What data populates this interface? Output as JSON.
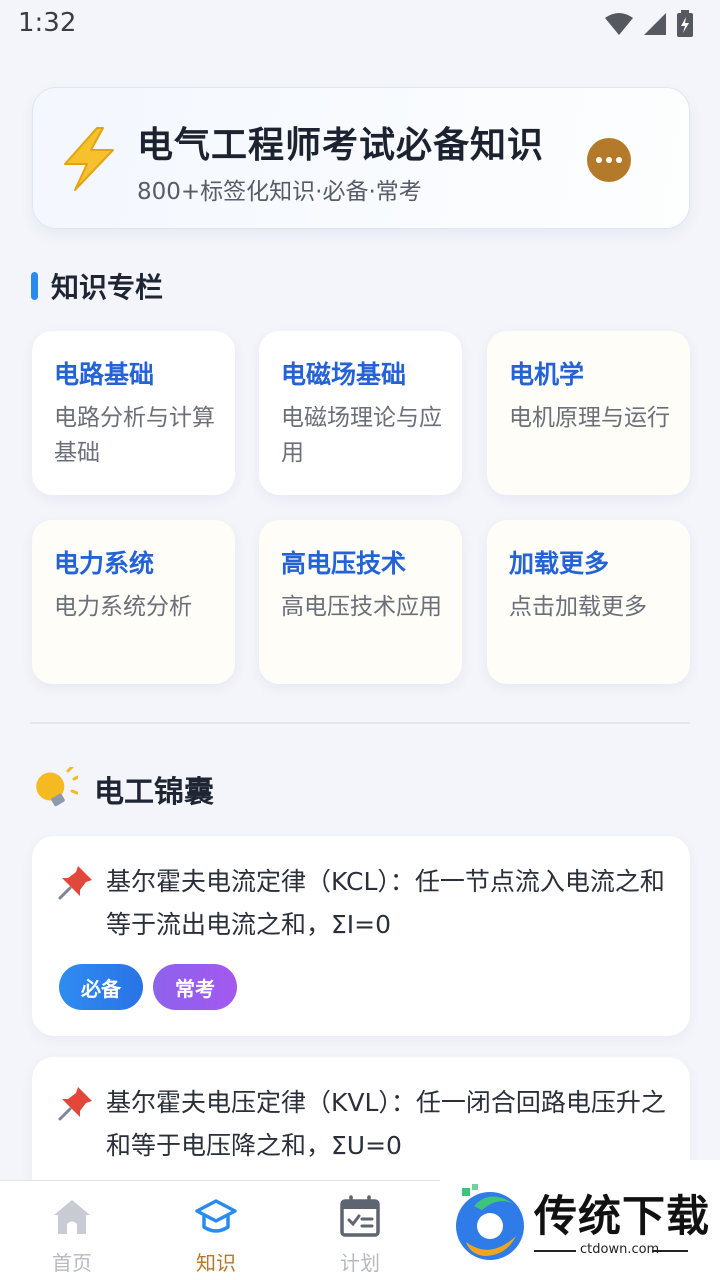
{
  "status_bar": {
    "time": "1:32"
  },
  "header": {
    "title": "电气工程师考试必备知识",
    "subtitle": "800+标签化知识·必备·常考",
    "icon": "lightning-icon",
    "more_icon": "more-dots-icon"
  },
  "topics_section": {
    "title": "知识专栏",
    "items": [
      {
        "name": "电路基础",
        "desc": "电路分析与计算基础"
      },
      {
        "name": "电磁场基础",
        "desc": "电磁场理论与应用"
      },
      {
        "name": "电机学",
        "desc": "电机原理与运行"
      },
      {
        "name": "电力系统",
        "desc": "电力系统分析"
      },
      {
        "name": "高电压技术",
        "desc": "高电压技术应用"
      },
      {
        "name": "加载更多",
        "desc": "点击加载更多"
      }
    ]
  },
  "tips_section": {
    "title": "电工锦囊",
    "icon": "lightbulb-icon",
    "items": [
      {
        "text": "基尔霍夫电流定律（KCL）：任一节点流入电流之和等于流出电流之和，ΣI=0",
        "tags": [
          "必备",
          "常考"
        ]
      },
      {
        "text": "基尔霍夫电压定律（KVL）：任一闭合回路电压升之和等于电压降之和，ΣU=0"
      }
    ]
  },
  "bottom_nav": {
    "items": [
      {
        "label": "首页",
        "icon": "home-icon"
      },
      {
        "label": "知识",
        "icon": "graduation-cap-icon"
      },
      {
        "label": "计划",
        "icon": "calendar-check-icon"
      }
    ],
    "active": "知识"
  },
  "watermark": {
    "brand": "传统下载",
    "url": "ctdown.com"
  },
  "colors": {
    "accent": "#b47a2a",
    "topic_title": "#2463d6",
    "section_bar": "#2a8bef",
    "tag_blue": "#2a73e6",
    "tag_purple": "#a458f0"
  }
}
